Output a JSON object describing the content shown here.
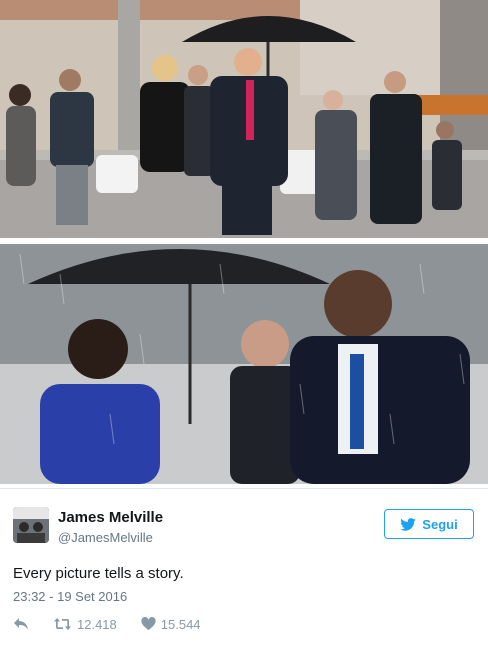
{
  "tweet": {
    "display_name": "James Melville",
    "handle": "@JamesMelville",
    "follow_label": "Segui",
    "text": "Every picture tells a story.",
    "timestamp": "23:32 - 19 Set 2016",
    "retweets": "12.418",
    "likes": "15.544"
  },
  "icons": {
    "follow": "twitter-bird-icon",
    "reply": "reply-icon",
    "retweet": "retweet-icon",
    "like": "heart-icon"
  },
  "colors": {
    "accent": "#1da1f2",
    "text": "#14171a",
    "muted": "#657786",
    "action": "#8899a6"
  }
}
